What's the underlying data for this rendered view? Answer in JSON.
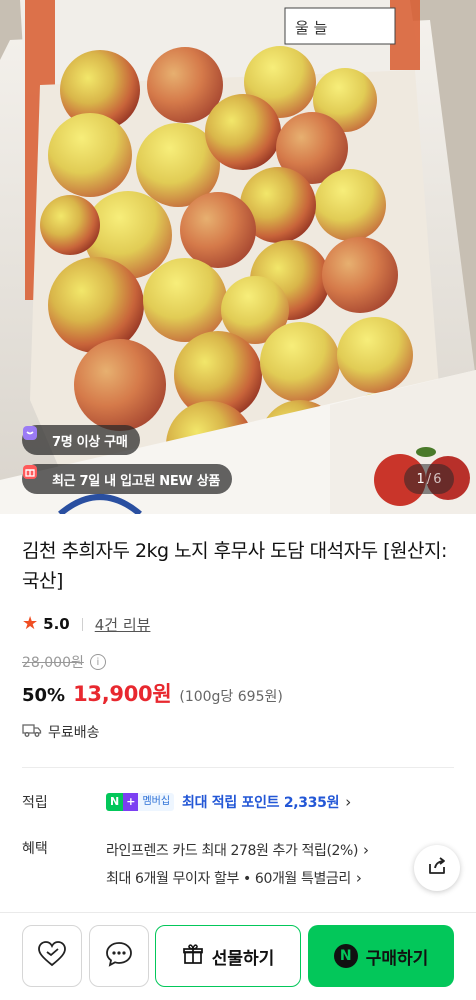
{
  "hero": {
    "badge_buyers": "7명 이상 구매",
    "badge_new": "최근 7일 내 입고된 NEW 상품",
    "image_index": "1",
    "image_total": "6",
    "box_logo": "울 늘"
  },
  "product": {
    "title": "김천 추희자두 2kg 노지 후무사 도담 대석자두 [원산지:국산]",
    "rating": "5.0",
    "reviews": "4건 리뷰",
    "original_price": "28,000원",
    "discount": "50%",
    "price": "13,900원",
    "unit_price": "(100g당 695원)",
    "shipping": "무료배송"
  },
  "points": {
    "label": "적립",
    "npay_n": "N",
    "npay_plus": "+",
    "npay_member": "멤버십",
    "text": "최대 적립 포인트 2,335원"
  },
  "benefits": {
    "label": "혜택",
    "lines": [
      "라인프렌즈 카드 최대 278원 추가 적립(2%)",
      "최대 6개월 무이자 할부 • 60개월 특별금리"
    ]
  },
  "bottom_bar": {
    "gift_label": "선물하기",
    "buy_label": "구매하기",
    "buy_logo": "N"
  },
  "colors": {
    "naver_green": "#03c75a",
    "price_red": "#e8282f",
    "point_blue": "#2357d6",
    "star_orange": "#f04e23"
  },
  "icons": [
    "bag-icon",
    "gift-box-icon",
    "info-icon",
    "truck-icon",
    "chevron-right-icon",
    "share-icon",
    "heart-check-icon",
    "chat-bubble-icon",
    "gift-icon",
    "naver-n-icon",
    "star-icon"
  ]
}
